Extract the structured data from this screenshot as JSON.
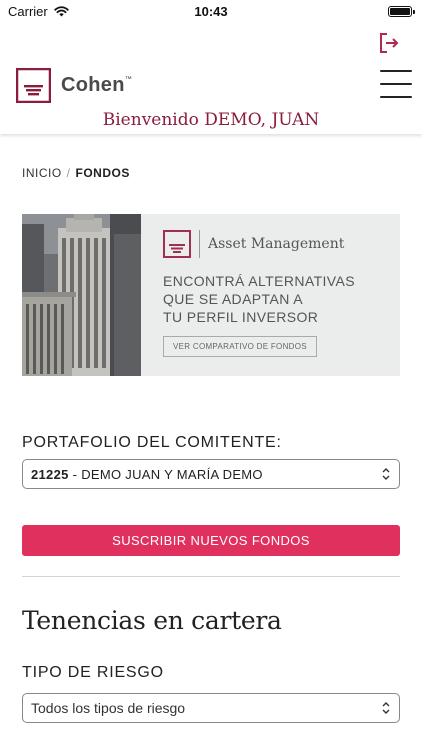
{
  "status_bar": {
    "carrier": "Carrier",
    "time": "10:43",
    "wifi_icon": "wifi-icon",
    "battery_icon": "battery-icon"
  },
  "header": {
    "logo_text": "Cohen",
    "logo_tm": "™",
    "welcome_prefix": "Bienvenido",
    "user_name": "DEMO, JUAN",
    "logout_icon": "logout-icon",
    "menu_icon": "hamburger-menu-icon"
  },
  "breadcrumb": {
    "home": "INICIO",
    "separator": "/",
    "current": "FONDOS"
  },
  "banner": {
    "brand": "Asset Management",
    "line1": "ENCONTRÁ ALTERNATIVAS",
    "line2": "QUE SE ADAPTAN A",
    "line3": "TU PERFIL INVERSOR",
    "button_label": "VER COMPARATIVO DE FONDOS"
  },
  "portfolio": {
    "label": "PORTAFOLIO DEL COMITENTE:",
    "selected_code": "21225",
    "selected_name": "- DEMO JUAN Y MARÍA DEMO"
  },
  "cta_label": "SUSCRIBIR NUEVOS FONDOS",
  "holdings": {
    "title": "Tenencias en cartera",
    "risk_label": "TIPO DE RIESGO",
    "risk_selected": "Todos los tipos de riesgo"
  },
  "colors": {
    "brand": "#8a1c3c",
    "accent": "#e0315e",
    "banner_bg": "#ebecec"
  }
}
